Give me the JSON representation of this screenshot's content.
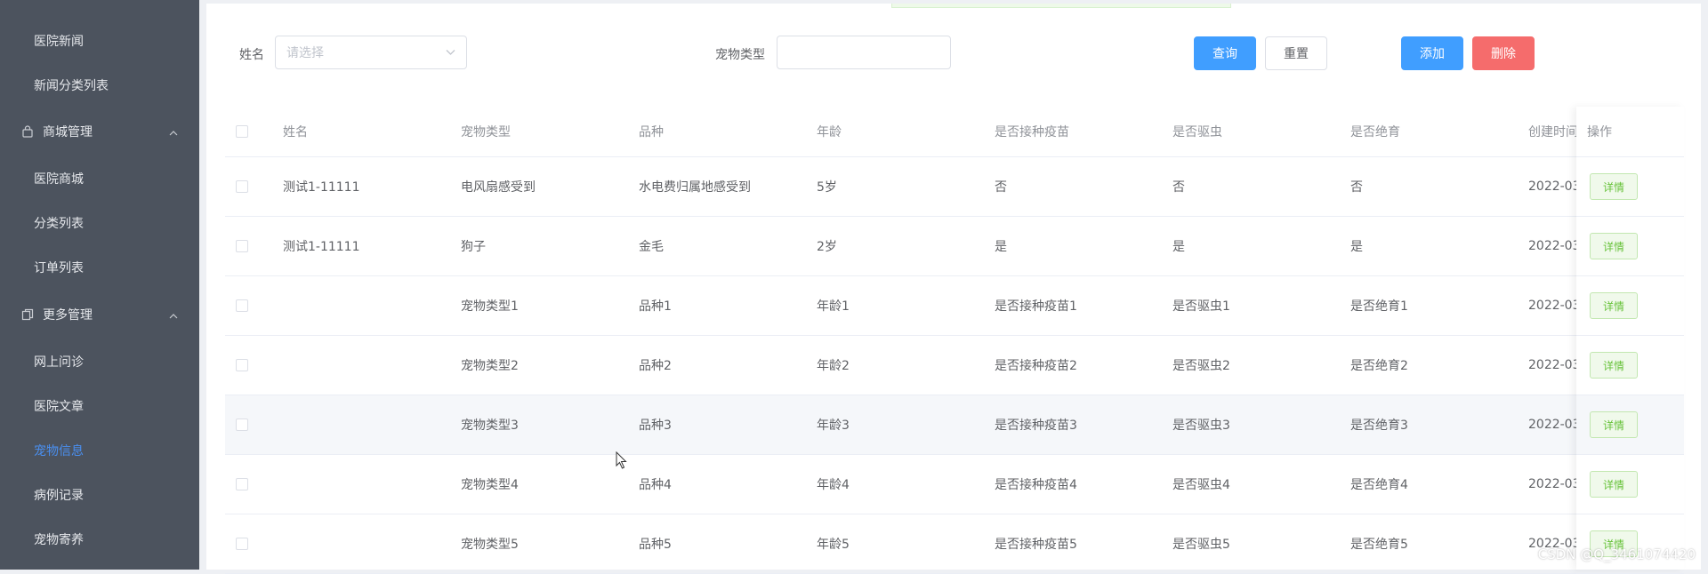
{
  "sidebar": {
    "items": [
      {
        "label": "医院新闻",
        "kind": "sub"
      },
      {
        "label": "新闻分类列表",
        "kind": "sub"
      },
      {
        "label": "商城管理",
        "kind": "group",
        "icon": "bag-icon"
      },
      {
        "label": "医院商城",
        "kind": "sub"
      },
      {
        "label": "分类列表",
        "kind": "sub"
      },
      {
        "label": "订单列表",
        "kind": "sub"
      },
      {
        "label": "更多管理",
        "kind": "group",
        "icon": "copy-icon"
      },
      {
        "label": "网上问诊",
        "kind": "sub"
      },
      {
        "label": "医院文章",
        "kind": "sub"
      },
      {
        "label": "宠物信息",
        "kind": "sub",
        "active": true
      },
      {
        "label": "病例记录",
        "kind": "sub"
      },
      {
        "label": "宠物寄养",
        "kind": "sub"
      }
    ]
  },
  "search": {
    "name_label": "姓名",
    "name_placeholder": "请选择",
    "pet_type_label": "宠物类型",
    "pet_type_value": "",
    "query_btn": "查询",
    "reset_btn": "重置",
    "add_btn": "添加",
    "delete_btn": "删除"
  },
  "table": {
    "columns": [
      "姓名",
      "宠物类型",
      "品种",
      "年龄",
      "是否接种疫苗",
      "是否驱虫",
      "是否绝育",
      "创建时间"
    ],
    "op_header": "操作",
    "detail_label": "详情",
    "rows": [
      [
        "测试1-11111",
        "电风扇感受到",
        "水电费归属地感受到",
        "5岁",
        "否",
        "否",
        "否",
        "2022-03-"
      ],
      [
        "测试1-11111",
        "狗子",
        "金毛",
        "2岁",
        "是",
        "是",
        "是",
        "2022-03-"
      ],
      [
        "",
        "宠物类型1",
        "品种1",
        "年龄1",
        "是否接种疫苗1",
        "是否驱虫1",
        "是否绝育1",
        "2022-03-"
      ],
      [
        "",
        "宠物类型2",
        "品种2",
        "年龄2",
        "是否接种疫苗2",
        "是否驱虫2",
        "是否绝育2",
        "2022-03-"
      ],
      [
        "",
        "宠物类型3",
        "品种3",
        "年龄3",
        "是否接种疫苗3",
        "是否驱虫3",
        "是否绝育3",
        "2022-03-"
      ],
      [
        "",
        "宠物类型4",
        "品种4",
        "年龄4",
        "是否接种疫苗4",
        "是否驱虫4",
        "是否绝育4",
        "2022-03-"
      ],
      [
        "",
        "宠物类型5",
        "品种5",
        "年龄5",
        "是否接种疫苗5",
        "是否驱虫5",
        "是否绝育5",
        "2022-03"
      ]
    ],
    "hover_row": 4
  },
  "watermark": "CSDN @Q_3461074420",
  "colors": {
    "sidebar_bg": "#4c535e",
    "active": "#4a8ff0",
    "primary": "#409eff",
    "danger": "#f56c6c",
    "success": "#67c23a"
  }
}
